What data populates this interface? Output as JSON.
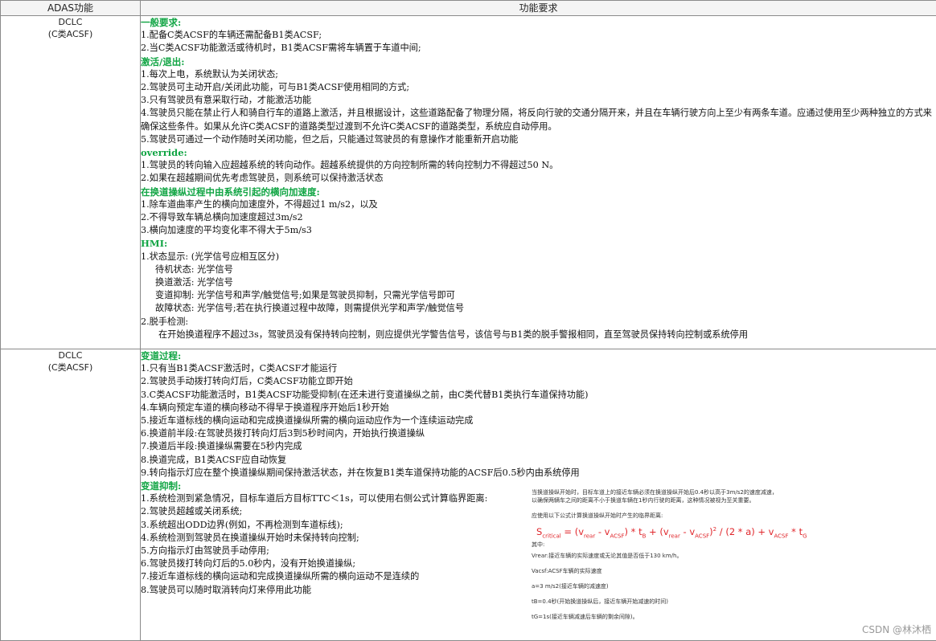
{
  "header": {
    "col1": "ADAS功能",
    "col2": "功能要求"
  },
  "row1": {
    "function": "DCLC",
    "function_sub": "(C类ACSF)",
    "lines": [
      {
        "t": "一般要求:",
        "k": "sec"
      },
      {
        "t": "1.配备C类ACSF的车辆还需配备B1类ACSF;"
      },
      {
        "t": "2.当C类ACSF功能激活或待机时，B1类ACSF需将车辆置于车道中间;"
      },
      {
        "t": "激活/退出:",
        "k": "sec"
      },
      {
        "t": "1.每次上电，系统默认为关闭状态;"
      },
      {
        "t": "2.驾驶员可主动开启/关闭此功能，可与B1类ACSF使用相同的方式;"
      },
      {
        "t": "3.只有驾驶员有意采取行动，才能激活功能"
      },
      {
        "t": "4.驾驶员只能在禁止行人和骑自行车的道路上激活，并且根据设计，这些道路配备了物理分隔，将反向行驶的交通分隔开来，并且在车辆行驶方向上至少有两条车道。应通过使用至少两种独立的方式来确保这些条件。如果从允许C类ACSF的道路类型过渡到不允许C类ACSF的道路类型，系统应自动停用。",
        "k": "wrap"
      },
      {
        "t": "5.驾驶员可通过一个动作随时关闭功能，但之后，只能通过驾驶员的有意操作才能重新开启功能"
      },
      {
        "t": "override:",
        "k": "sec"
      },
      {
        "t": "1.驾驶员的转向输入应超越系统的转向动作。超越系统提供的方向控制所需的转向控制力不得超过50 N。"
      },
      {
        "t": "2.如果在超越期间优先考虑驾驶员，则系统可以保持激活状态"
      },
      {
        "t": "在换道操纵过程中由系统引起的横向加速度:",
        "k": "sec"
      },
      {
        "t": "1.除车道曲率产生的横向加速度外，不得超过1 m/s2，以及"
      },
      {
        "t": "2.不得导致车辆总横向加速度超过3m/s2"
      },
      {
        "t": "3.横向加速度的平均变化率不得大于5m/s3"
      },
      {
        "t": "HMI:",
        "k": "sec"
      },
      {
        "t": "1.状态显示:  (光学信号应相互区分)"
      },
      {
        "t": "待机状态:  光学信号",
        "k": "ind"
      },
      {
        "t": "换道激活:  光学信号",
        "k": "ind"
      },
      {
        "t": "变道抑制:  光学信号和声学/触觉信号;如果是驾驶员抑制，只需光学信号即可",
        "k": "ind"
      },
      {
        "t": "故障状态:  光学信号;若在执行换道过程中故障，则需提供光学和声学/触觉信号",
        "k": "ind"
      },
      {
        "t": "2.脱手检测:"
      },
      {
        "t": "在开始换道程序不超过3s，驾驶员没有保持转向控制，则应提供光学警告信号，该信号与B1类的脱手警报相同，直至驾驶员保持转向控制或系统停用",
        "k": "ind2"
      }
    ]
  },
  "row2": {
    "function": "DCLC",
    "function_sub": "(C类ACSF)",
    "lines": [
      {
        "t": "变道过程:",
        "k": "sec"
      },
      {
        "t": "1.只有当B1类ACSF激活时，C类ACSF才能运行"
      },
      {
        "t": "2.驾驶员手动拨打转向灯后，C类ACSF功能立即开始"
      },
      {
        "t": "3.C类ACSF功能激活时，B1类ACSF功能受抑制(在还未进行变道操纵之前，由C类代替B1类执行车道保持功能)"
      },
      {
        "t": "4.车辆向预定车道的横向移动不得早于换道程序开始后1秒开始"
      },
      {
        "t": "5.接近车道标线的横向运动和完成换道操纵所需的横向运动应作为一个连续运动完成"
      },
      {
        "t": "6.换道前半段:在驾驶员拨打转向灯后3到5秒时间内，开始执行换道操纵"
      },
      {
        "t": "7.换道后半段:换道操纵需要在5秒内完成"
      },
      {
        "t": "8.换道完成，B1类ACSF应自动恢复"
      },
      {
        "t": "9.转向指示灯应在整个换道操纵期间保持激活状态，并在恢复B1类车道保持功能的ACSF后0.5秒内由系统停用"
      },
      {
        "t": "变道抑制:",
        "k": "sec"
      },
      {
        "t": "1.系统检测到紧急情况，目标车道后方目标TTC＜1s，可以使用右侧公式计算临界距离:"
      },
      {
        "t": "2.驾驶员超越或关闭系统;"
      },
      {
        "t": "3.系统超出ODD边界(例如，不再检测到车道标线);"
      },
      {
        "t": "4.系统检测到驾驶员在换道操纵开始时未保持转向控制;"
      },
      {
        "t": "5.方向指示灯由驾驶员手动停用;"
      },
      {
        "t": "6.驾驶员拨打转向灯后的5.0秒内，没有开始换道操纵;"
      },
      {
        "t": "7.接近车道标线的横向运动和完成换道操纵所需的横向运动不是连续的"
      },
      {
        "t": "8.驾驶员可以随时取消转向灯来停用此功能"
      }
    ],
    "formula": {
      "note1": "当换道操纵开始时，目标车道上的接近车辆必须在换道操纵开始后0.4秒以高于3m/s2的速度减速，",
      "note2": "以确保两辆车之间的距离不小于换道车辆在1秒内行驶的距离，这种情况被视为至关重要。",
      "note3": "应使用以下公式计算换道操纵开始时产生的临界距离:",
      "expr_s": "S",
      "expr_s_sub": "critical",
      "expr_eq": " = (v",
      "expr_rear": "rear",
      "expr_minus": " - v",
      "expr_acsf": "ACSF",
      "expr_mid": ") * t",
      "expr_b": "B",
      "expr_plus": " + (v",
      "expr_close": ")",
      "expr_sq": "2",
      "expr_div": " / (2 * a) + v",
      "expr_tg": " * t",
      "expr_g": "G",
      "where": "其中:",
      "item1": "Vrear:接近车辆的实际速度或无论其值是否低于130 km/h。",
      "item2": "Vacsf:ACSF车辆的实际速度",
      "item3": "a=3 m/s2(接近车辆的减速度)",
      "item4": "tB=0.4秒(开始换道操纵后，接近车辆开始减速的时间)",
      "item5": "tG=1s(接近车辆减速后车辆的剩余间隙)。"
    }
  },
  "watermark": "CSDN @林沐栖"
}
